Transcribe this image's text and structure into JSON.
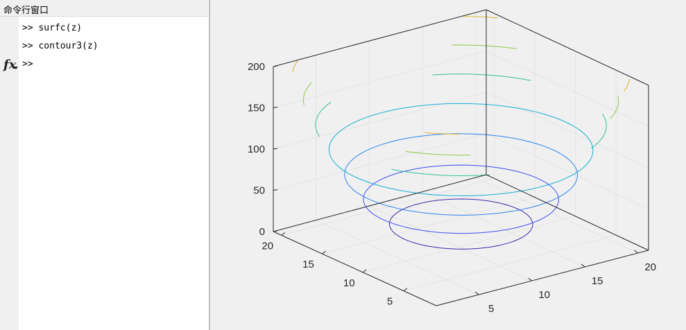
{
  "command_window": {
    "title": "命令行窗口",
    "prompt": ">>",
    "lines": [
      "surfc(z)",
      "contour3(z)",
      ""
    ],
    "fx_icon": "fx-function-browser-icon"
  },
  "chart_data": {
    "type": "contour3",
    "x_ticks": [
      "5",
      "10",
      "15",
      "20"
    ],
    "y_ticks": [
      "5",
      "10",
      "15",
      "20"
    ],
    "z_ticks": [
      "0",
      "50",
      "100",
      "150",
      "200"
    ],
    "xlim": [
      1,
      21
    ],
    "ylim": [
      1,
      21
    ],
    "zlim": [
      0,
      200
    ],
    "grid": true,
    "contour_levels": [
      {
        "z": 20,
        "color": "#3e26a8"
      },
      {
        "z": 50,
        "color": "#3d4cf0"
      },
      {
        "z": 80,
        "color": "#2f82ef"
      },
      {
        "z": 110,
        "color": "#13aed5"
      },
      {
        "z": 140,
        "color": "#2fbe9a"
      },
      {
        "z": 170,
        "color": "#8cc648"
      },
      {
        "z": 200,
        "color": "#dcb431"
      }
    ]
  }
}
